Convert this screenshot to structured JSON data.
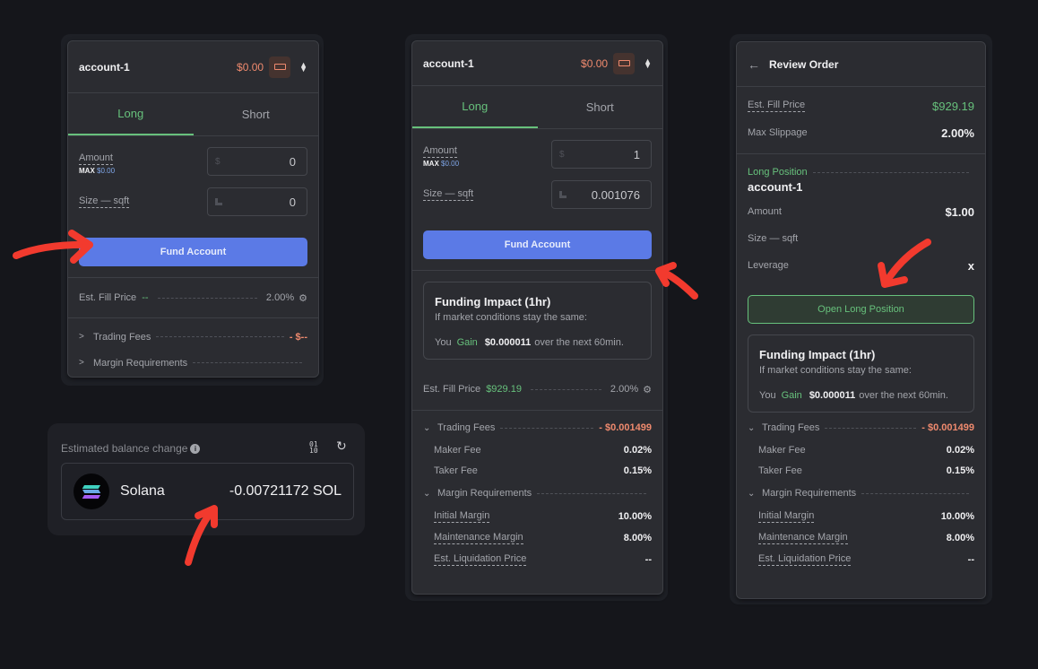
{
  "panel1": {
    "account": "account-1",
    "balance": "$0.00",
    "tabs": [
      "Long",
      "Short"
    ],
    "amount_label": "Amount",
    "max_label": "MAX",
    "max_value": "$0.00",
    "amount_value": "0",
    "amount_prefix": "$",
    "size_label": "Size — sqft",
    "size_value": "0",
    "fund_button": "Fund Account",
    "fill_label": "Est. Fill Price",
    "fill_value": "--",
    "slippage": "2.00%",
    "trading_fees_label": "Trading Fees",
    "trading_fees_value": "- $--",
    "margin_label": "Margin Requirements"
  },
  "balance_change": {
    "title": "Estimated balance change",
    "info_icon": "i",
    "binary_icon": [
      "01",
      "10"
    ],
    "reset_icon": "↻",
    "token_name": "Solana",
    "amount": "-0.00721172 SOL"
  },
  "panel2": {
    "account": "account-1",
    "balance": "$0.00",
    "tabs": [
      "Long",
      "Short"
    ],
    "amount_label": "Amount",
    "max_label": "MAX",
    "max_value": "$0.00",
    "amount_value": "1",
    "amount_prefix": "$",
    "size_label": "Size — sqft",
    "size_value": "0.001076",
    "fund_button": "Fund Account",
    "impact_title": "Funding Impact (1hr)",
    "impact_sub": "If market conditions stay the same:",
    "impact_you": "You",
    "impact_gain": "Gain",
    "impact_amount": "$0.000011",
    "impact_suffix": "over the next 60min.",
    "fill_label": "Est. Fill Price",
    "fill_value": "$929.19",
    "slippage": "2.00%",
    "trading_fees_label": "Trading Fees",
    "trading_fees_value": "- $0.001499",
    "maker_label": "Maker Fee",
    "maker_value": "0.02%",
    "taker_label": "Taker Fee",
    "taker_value": "0.15%",
    "margin_label": "Margin Requirements",
    "initial_label": "Initial Margin",
    "initial_value": "10.00%",
    "maint_label": "Maintenance Margin",
    "maint_value": "8.00%",
    "liq_label": "Est. Liquidation Price",
    "liq_value": "--"
  },
  "panel3": {
    "back_icon": "←",
    "title": "Review Order",
    "fill_label": "Est. Fill Price",
    "fill_value": "$929.19",
    "slippage_label": "Max Slippage",
    "slippage_value": "2.00%",
    "position_label": "Long Position",
    "account": "account-1",
    "amount_label": "Amount",
    "amount_value": "$1.00",
    "size_label": "Size — sqft",
    "size_value": "",
    "leverage_label": "Leverage",
    "leverage_value": "x",
    "open_button": "Open Long Position",
    "impact_title": "Funding Impact (1hr)",
    "impact_sub": "If market conditions stay the same:",
    "impact_you": "You",
    "impact_gain": "Gain",
    "impact_amount": "$0.000011",
    "impact_suffix": "over the next 60min.",
    "trading_fees_label": "Trading Fees",
    "trading_fees_value": "- $0.001499",
    "maker_label": "Maker Fee",
    "maker_value": "0.02%",
    "taker_label": "Taker Fee",
    "taker_value": "0.15%",
    "margin_label": "Margin Requirements",
    "initial_label": "Initial Margin",
    "initial_value": "10.00%",
    "maint_label": "Maintenance Margin",
    "maint_value": "8.00%",
    "liq_label": "Est. Liquidation Price",
    "liq_value": "--"
  },
  "colors": {
    "accent_green": "#67c17c",
    "accent_orange": "#ef8a6e",
    "fund_blue": "#5b7ae6",
    "annotation_red": "#f23a2e"
  }
}
